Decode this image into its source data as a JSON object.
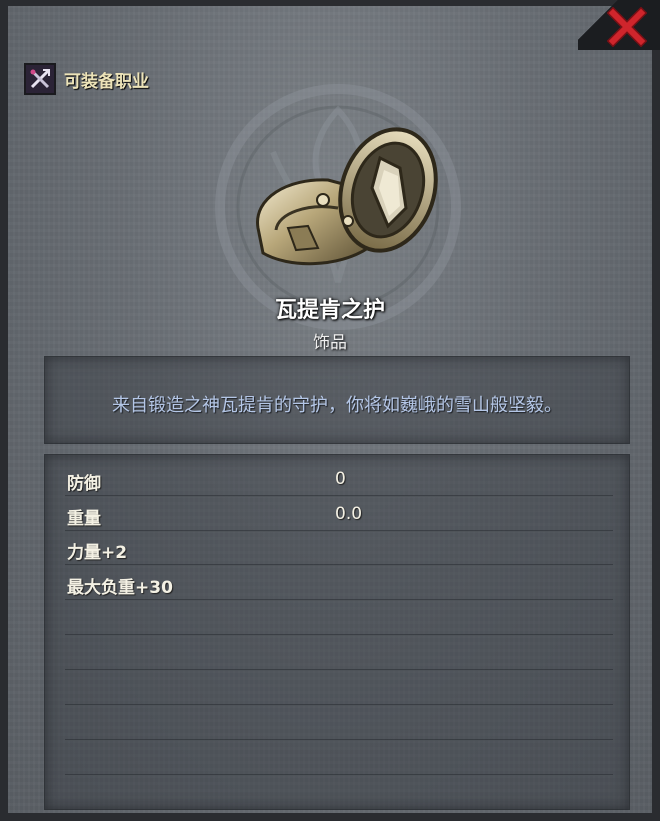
{
  "header": {
    "class_label": "可装备职业",
    "class_icon": "crossed-weapons-icon",
    "close_icon": "close-x-icon"
  },
  "item": {
    "name": "瓦提肯之护",
    "type": "饰品",
    "description": "来自锻造之神瓦提肯的守护，你将如巍峨的雪山般坚毅。",
    "image_icon": "ring-icon"
  },
  "stats": [
    {
      "label": "防御",
      "value": "0"
    },
    {
      "label": "重量",
      "value": "0.0"
    }
  ],
  "bonuses": [
    "力量+2",
    "最大负重+30"
  ],
  "colors": {
    "description_text": "#b4c6e6",
    "close_red": "#c8232a",
    "class_label": "#ece3b8"
  }
}
